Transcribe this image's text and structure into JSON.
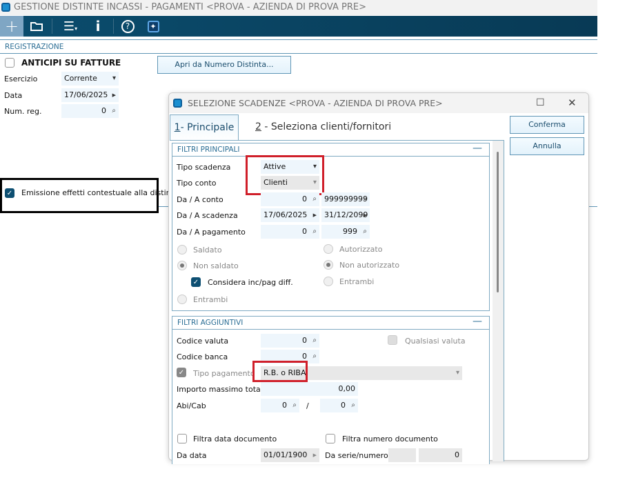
{
  "main": {
    "title": "GESTIONE DISTINTE INCASSI - PAGAMENTI <PROVA - AZIENDA DI PROVA PRE>",
    "toolbar": [
      {
        "icon": "plus-icon"
      },
      {
        "icon": "folder-icon"
      },
      {
        "icon": "menu-icon"
      },
      {
        "icon": "info-icon"
      },
      {
        "icon": "help-icon"
      },
      {
        "icon": "sparkle-icon"
      }
    ],
    "section": "REGISTRAZIONE",
    "anticipi_label": "ANTICIPI SU FATTURE",
    "anticipi_checked": false,
    "apri_button": "Apri da Numero Distinta...",
    "esercizio_label": "Esercizio",
    "esercizio_value": "Corrente",
    "data_label": "Data",
    "data_value": "17/06/2025",
    "numreg_label": "Num. reg.",
    "numreg_value": "0",
    "emissione_label": "Emissione effetti contestuale alla distinta",
    "emissione_checked": true
  },
  "dialog": {
    "title": "SELEZIONE SCADENZE <PROVA - AZIENDA DI PROVA PRE>",
    "tabs": [
      {
        "num": "1",
        "label": "- Principale",
        "active": true
      },
      {
        "num": "2",
        "label": " - Seleziona clienti/fornitori",
        "active": false
      }
    ],
    "conferma": "Conferma",
    "annulla": "Annulla",
    "principali": {
      "header": "FILTRI PRINCIPALI",
      "tipo_scadenza_label": "Tipo scadenza",
      "tipo_scadenza": "Attive",
      "tipo_conto_label": "Tipo conto",
      "tipo_conto": "Clienti",
      "conto_label": "Da / A conto",
      "conto_da": "0",
      "conto_a": "999999999",
      "scadenza_label": "Da / A scadenza",
      "scadenza_da": "17/06/2025",
      "scadenza_a": "31/12/2099",
      "pagamento_label": "Da / A pagamento",
      "pagamento_da": "0",
      "pagamento_a": "999",
      "saldato": "Saldato",
      "non_saldato": "Non saldato",
      "considera": "Considera inc/pag diff.",
      "entrambi1": "Entrambi",
      "autorizzato": "Autorizzato",
      "non_autorizzato": "Non autorizzato",
      "entrambi2": "Entrambi",
      "saldo_selected": "Non saldato",
      "autorizz_selected": "Non autorizzato",
      "considera_checked": true
    },
    "aggiuntivi": {
      "header": "FILTRI AGGIUNTIVI",
      "valuta_label": "Codice valuta",
      "valuta": "0",
      "qualsiasi_valuta": "Qualsiasi valuta",
      "banca_label": "Codice banca",
      "banca": "0",
      "tipo_pag_label": "Tipo pagamento",
      "tipo_pag": "R.B. o RIBA",
      "tipo_pag_checked": true,
      "importo_label": "Importo massimo totale",
      "importo": "0,00",
      "abicab_label": "Abi/Cab",
      "abi": "0",
      "cab": "0",
      "slash": "/",
      "filtra_data": "Filtra data documento",
      "filtra_numero": "Filtra numero documento",
      "da_data_label": "Da data",
      "da_data": "01/01/1900",
      "da_serie_label": "Da serie/numero",
      "da_numero": "0"
    }
  },
  "colors": {
    "toolbar": "#0b4d6e",
    "accent": "#2a6d94",
    "highlight": "#d01f2a"
  }
}
